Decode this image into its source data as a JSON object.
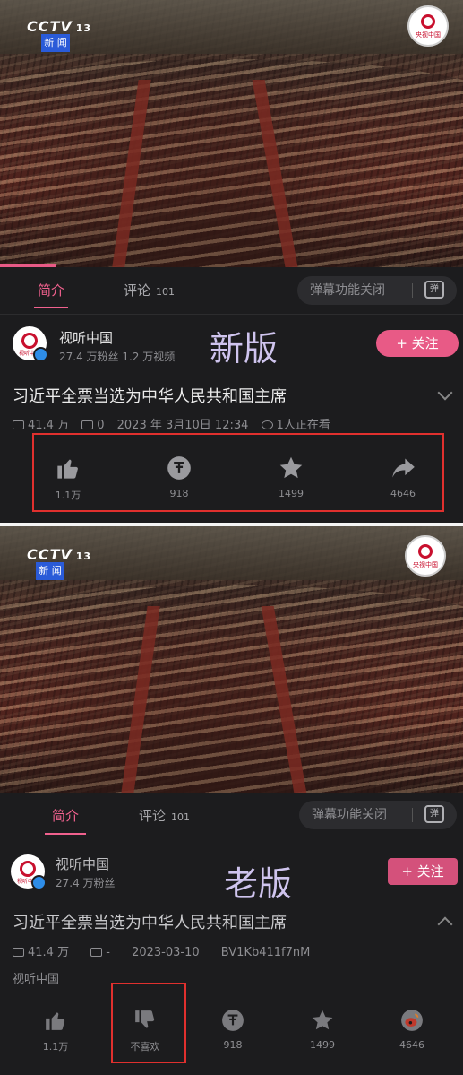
{
  "new_version": {
    "stamp": "新版",
    "player": {
      "channel_logo": "CCTV",
      "channel_number": "13",
      "news_tag": "新 闻",
      "watermark_text": "央视中国"
    },
    "tabs": [
      {
        "label": "简介",
        "active": true
      },
      {
        "label": "评论",
        "count": "101",
        "active": false
      }
    ],
    "danmaku": {
      "label": "弹幕功能关闭",
      "icon_text": "弹"
    },
    "uploader": {
      "name": "视听中国",
      "stats": "27.4 万粉丝   1.2 万视频",
      "follow_label": "+ 关注"
    },
    "video": {
      "title": "习近平全票当选为中华人民共和国主席",
      "views": "41.4 万",
      "danmaku_count": "0",
      "date": "2023 年 3月10日 12:34",
      "watching": "1人正在看"
    },
    "actions": [
      {
        "icon": "thumbs-up-icon",
        "label": "1.1万"
      },
      {
        "icon": "coin-icon",
        "label": "918"
      },
      {
        "icon": "star-icon",
        "label": "1499"
      },
      {
        "icon": "share-icon",
        "label": "4646"
      }
    ]
  },
  "old_version": {
    "stamp": "老版",
    "player": {
      "channel_logo": "CCTV",
      "channel_number": "13",
      "news_tag": "新 闻",
      "watermark_text": "央视中国"
    },
    "tabs": [
      {
        "label": "简介",
        "active": true
      },
      {
        "label": "评论",
        "count": "101",
        "active": false
      }
    ],
    "danmaku": {
      "label": "弹幕功能关闭",
      "icon_text": "弹"
    },
    "uploader": {
      "name": "视听中国",
      "stats": "27.4 万粉丝",
      "follow_label": "+ 关注"
    },
    "video": {
      "title": "习近平全票当选为中华人民共和国主席",
      "views": "41.4 万",
      "danmaku_count": "-",
      "date": "2023-03-10",
      "bvid": "BV1Kb411f7nM",
      "uploader_line": "视听中国"
    },
    "actions": [
      {
        "icon": "thumbs-up-icon",
        "label": "1.1万"
      },
      {
        "icon": "thumbs-down-icon",
        "label": "不喜欢"
      },
      {
        "icon": "coin-icon",
        "label": "918"
      },
      {
        "icon": "star-icon",
        "label": "1499"
      },
      {
        "icon": "weibo-icon",
        "label": "4646"
      }
    ]
  },
  "colors": {
    "accent": "#e85a86",
    "background": "#1c1c1e",
    "highlight_box": "#e0302e"
  }
}
